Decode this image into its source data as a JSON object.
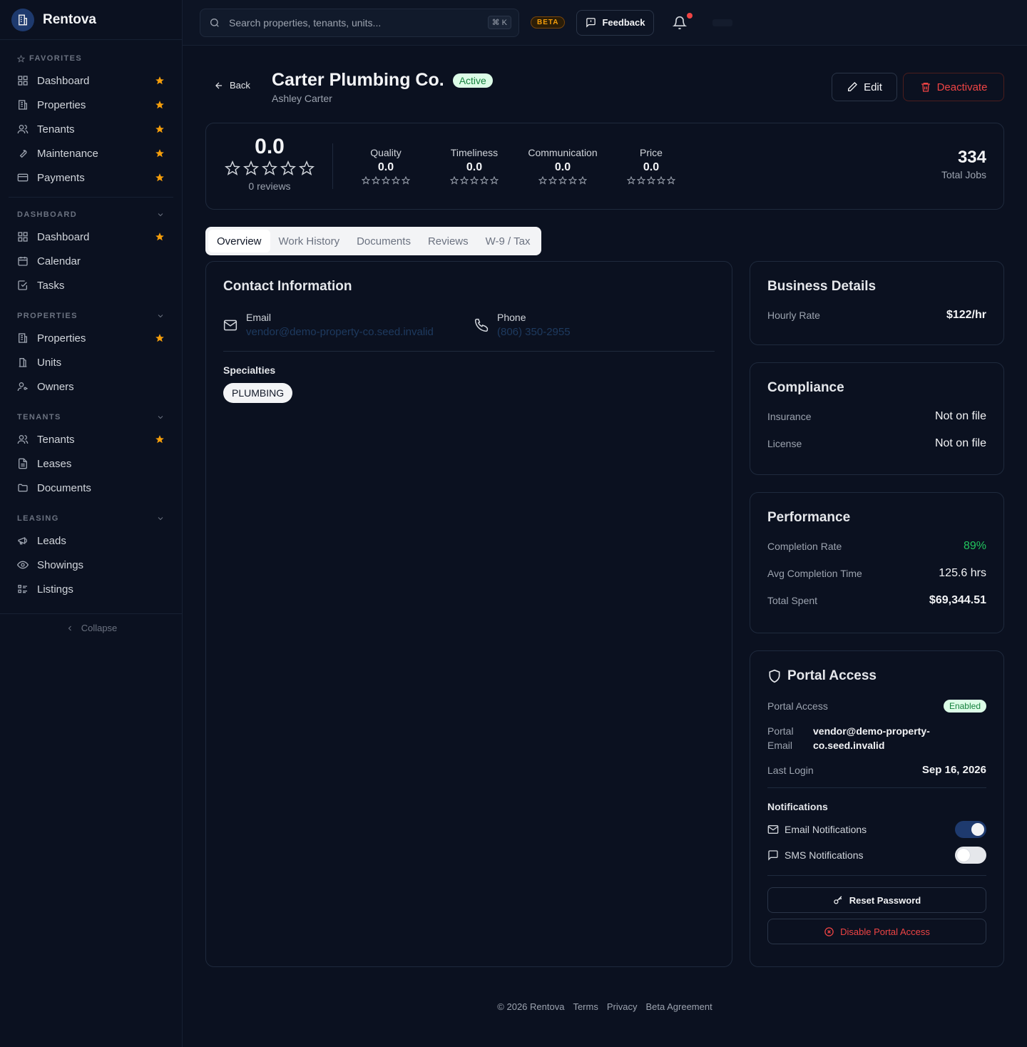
{
  "brand": {
    "name": "Rentova"
  },
  "sidebar": {
    "sections": [
      {
        "title": "FAVORITES",
        "items": [
          {
            "label": "Dashboard",
            "icon": "grid-icon",
            "starred": true
          },
          {
            "label": "Properties",
            "icon": "building-icon",
            "starred": true
          },
          {
            "label": "Tenants",
            "icon": "users-icon",
            "starred": true
          },
          {
            "label": "Maintenance",
            "icon": "wrench-icon",
            "starred": true
          },
          {
            "label": "Payments",
            "icon": "credit-card-icon",
            "starred": true
          }
        ]
      },
      {
        "title": "DASHBOARD",
        "items": [
          {
            "label": "Dashboard",
            "icon": "grid-icon",
            "starred": true
          },
          {
            "label": "Calendar",
            "icon": "calendar-icon",
            "starred": false
          },
          {
            "label": "Tasks",
            "icon": "check-square-icon",
            "starred": false
          }
        ]
      },
      {
        "title": "PROPERTIES",
        "items": [
          {
            "label": "Properties",
            "icon": "building-icon",
            "starred": true
          },
          {
            "label": "Units",
            "icon": "door-icon",
            "starred": false
          },
          {
            "label": "Owners",
            "icon": "user-key-icon",
            "starred": false
          }
        ]
      },
      {
        "title": "TENANTS",
        "items": [
          {
            "label": "Tenants",
            "icon": "users-icon",
            "starred": true
          },
          {
            "label": "Leases",
            "icon": "file-text-icon",
            "starred": false
          },
          {
            "label": "Documents",
            "icon": "folder-icon",
            "starred": false
          }
        ]
      },
      {
        "title": "LEASING",
        "items": [
          {
            "label": "Leads",
            "icon": "megaphone-icon",
            "starred": false
          },
          {
            "label": "Showings",
            "icon": "eye-icon",
            "starred": false
          },
          {
            "label": "Listings",
            "icon": "list-icon",
            "starred": false
          }
        ]
      }
    ],
    "collapse_label": "Collapse"
  },
  "topbar": {
    "search_placeholder": "Search properties, tenants, units...",
    "shortcut": "⌘ K",
    "beta": "BETA",
    "feedback": "Feedback"
  },
  "vendor": {
    "back": "Back",
    "name": "Carter Plumbing Co.",
    "status": "Active",
    "contact_name": "Ashley Carter",
    "edit": "Edit",
    "deactivate": "Deactivate"
  },
  "ratings": {
    "overall": "0.0",
    "reviews": "0 reviews",
    "categories": [
      {
        "label": "Quality",
        "value": "0.0"
      },
      {
        "label": "Timeliness",
        "value": "0.0"
      },
      {
        "label": "Communication",
        "value": "0.0"
      },
      {
        "label": "Price",
        "value": "0.0"
      }
    ],
    "total_jobs": "334",
    "total_jobs_label": "Total Jobs"
  },
  "tabs": [
    "Overview",
    "Work History",
    "Documents",
    "Reviews",
    "W-9 / Tax"
  ],
  "contact": {
    "title": "Contact Information",
    "email_label": "Email",
    "email": "vendor@demo-property-co.seed.invalid",
    "phone_label": "Phone",
    "phone": "(806) 350-2955",
    "specialties_label": "Specialties",
    "specialties": [
      "PLUMBING"
    ]
  },
  "business": {
    "title": "Business Details",
    "hourly_label": "Hourly Rate",
    "hourly": "$122/hr"
  },
  "compliance": {
    "title": "Compliance",
    "insurance_label": "Insurance",
    "insurance": "Not on file",
    "license_label": "License",
    "license": "Not on file"
  },
  "performance": {
    "title": "Performance",
    "completion_label": "Completion Rate",
    "completion": "89%",
    "avg_label": "Avg Completion Time",
    "avg": "125.6 hrs",
    "spent_label": "Total Spent",
    "spent": "$69,344.51",
    "accent": "#22c55e"
  },
  "portal": {
    "title": "Portal Access",
    "access_label": "Portal Access",
    "access_status": "Enabled",
    "email_label_1": "Portal",
    "email_label_2": "Email",
    "email_line_1": "vendor@demo-property-",
    "email_line_2": "co.seed.invalid",
    "last_login_label": "Last Login",
    "last_login": "Sep 16, 2026",
    "notifications_label": "Notifications",
    "email_notifications": "Email Notifications",
    "email_notifications_on": true,
    "sms_notifications": "SMS Notifications",
    "sms_notifications_on": false,
    "reset_password": "Reset Password",
    "disable_access": "Disable Portal Access"
  },
  "footer": {
    "copyright": "© 2026 Rentova",
    "terms": "Terms",
    "privacy": "Privacy",
    "beta_agreement": "Beta Agreement"
  },
  "colors": {
    "star": "#f59e0b",
    "danger": "#ef4444",
    "success": "#15803d"
  }
}
